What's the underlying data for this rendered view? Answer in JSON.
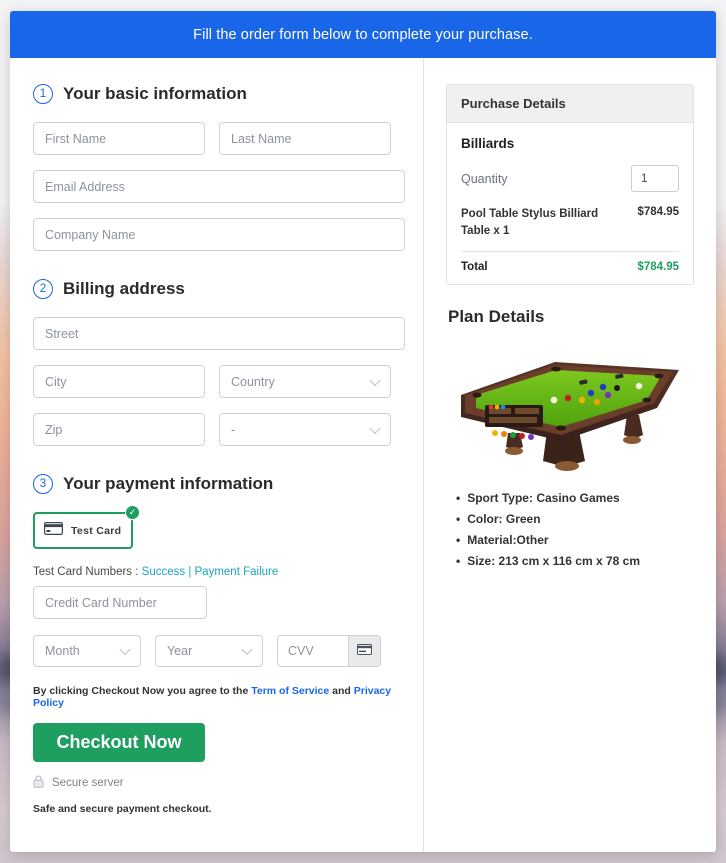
{
  "banner": {
    "text": "Fill the order form below to complete your purchase."
  },
  "colors": {
    "banner_blue": "#1a66e8",
    "accent_green": "#1e9e5f",
    "link_teal": "#1aa5bd",
    "link_blue": "#1a66e8",
    "total_green": "#1e9e5f"
  },
  "sections": {
    "basic": {
      "number": "1",
      "title": "Your basic information"
    },
    "billing": {
      "number": "2",
      "title": "Billing address"
    },
    "payment": {
      "number": "3",
      "title": "Your payment information"
    }
  },
  "fields": {
    "first_name": {
      "placeholder": "First Name",
      "value": ""
    },
    "last_name": {
      "placeholder": "Last Name",
      "value": ""
    },
    "email": {
      "placeholder": "Email Address",
      "value": ""
    },
    "company": {
      "placeholder": "Company Name",
      "value": ""
    },
    "street": {
      "placeholder": "Street",
      "value": ""
    },
    "city": {
      "placeholder": "City",
      "value": ""
    },
    "country": {
      "placeholder": "Country",
      "value": ""
    },
    "zip": {
      "placeholder": "Zip",
      "value": ""
    },
    "state": {
      "placeholder": "-",
      "value": ""
    },
    "credit_card": {
      "placeholder": "Credit Card Number",
      "value": ""
    },
    "month": {
      "placeholder": "Month",
      "value": ""
    },
    "year": {
      "placeholder": "Year",
      "value": ""
    },
    "cvv": {
      "placeholder": "CVV",
      "value": ""
    }
  },
  "payment_method": {
    "label": "Test Card",
    "selected": true,
    "icon": "credit-card-icon",
    "badge_icon": "check-circle-icon"
  },
  "test_cards": {
    "prefix": "Test Card Numbers : ",
    "success_label": "Success",
    "separator": " | ",
    "failure_label": "Payment Failure"
  },
  "terms": {
    "prefix": "By clicking Checkout Now you agree to the ",
    "tos_label": "Term of Service",
    "conjunction": " and ",
    "privacy_label": "Privacy Policy"
  },
  "actions": {
    "checkout_label": "Checkout Now",
    "secure_label": "Secure server",
    "secure_icon": "lock-icon",
    "safe_note": "Safe and secure payment checkout."
  },
  "purchase_details": {
    "heading": "Purchase Details",
    "product_group": "Billiards",
    "quantity_label": "Quantity",
    "quantity_value": "1",
    "line_item_name": "Pool Table Stylus Billiard Table x 1",
    "line_item_price": "$784.95",
    "total_label": "Total",
    "total_value": "$784.95"
  },
  "plan_details": {
    "heading": "Plan Details",
    "image_alt": "pool-table-photo",
    "bullets": [
      "Sport Type: Casino Games",
      "Color: Green",
      "Material:Other",
      "Size: 213 cm x 116 cm x 78 cm"
    ]
  }
}
